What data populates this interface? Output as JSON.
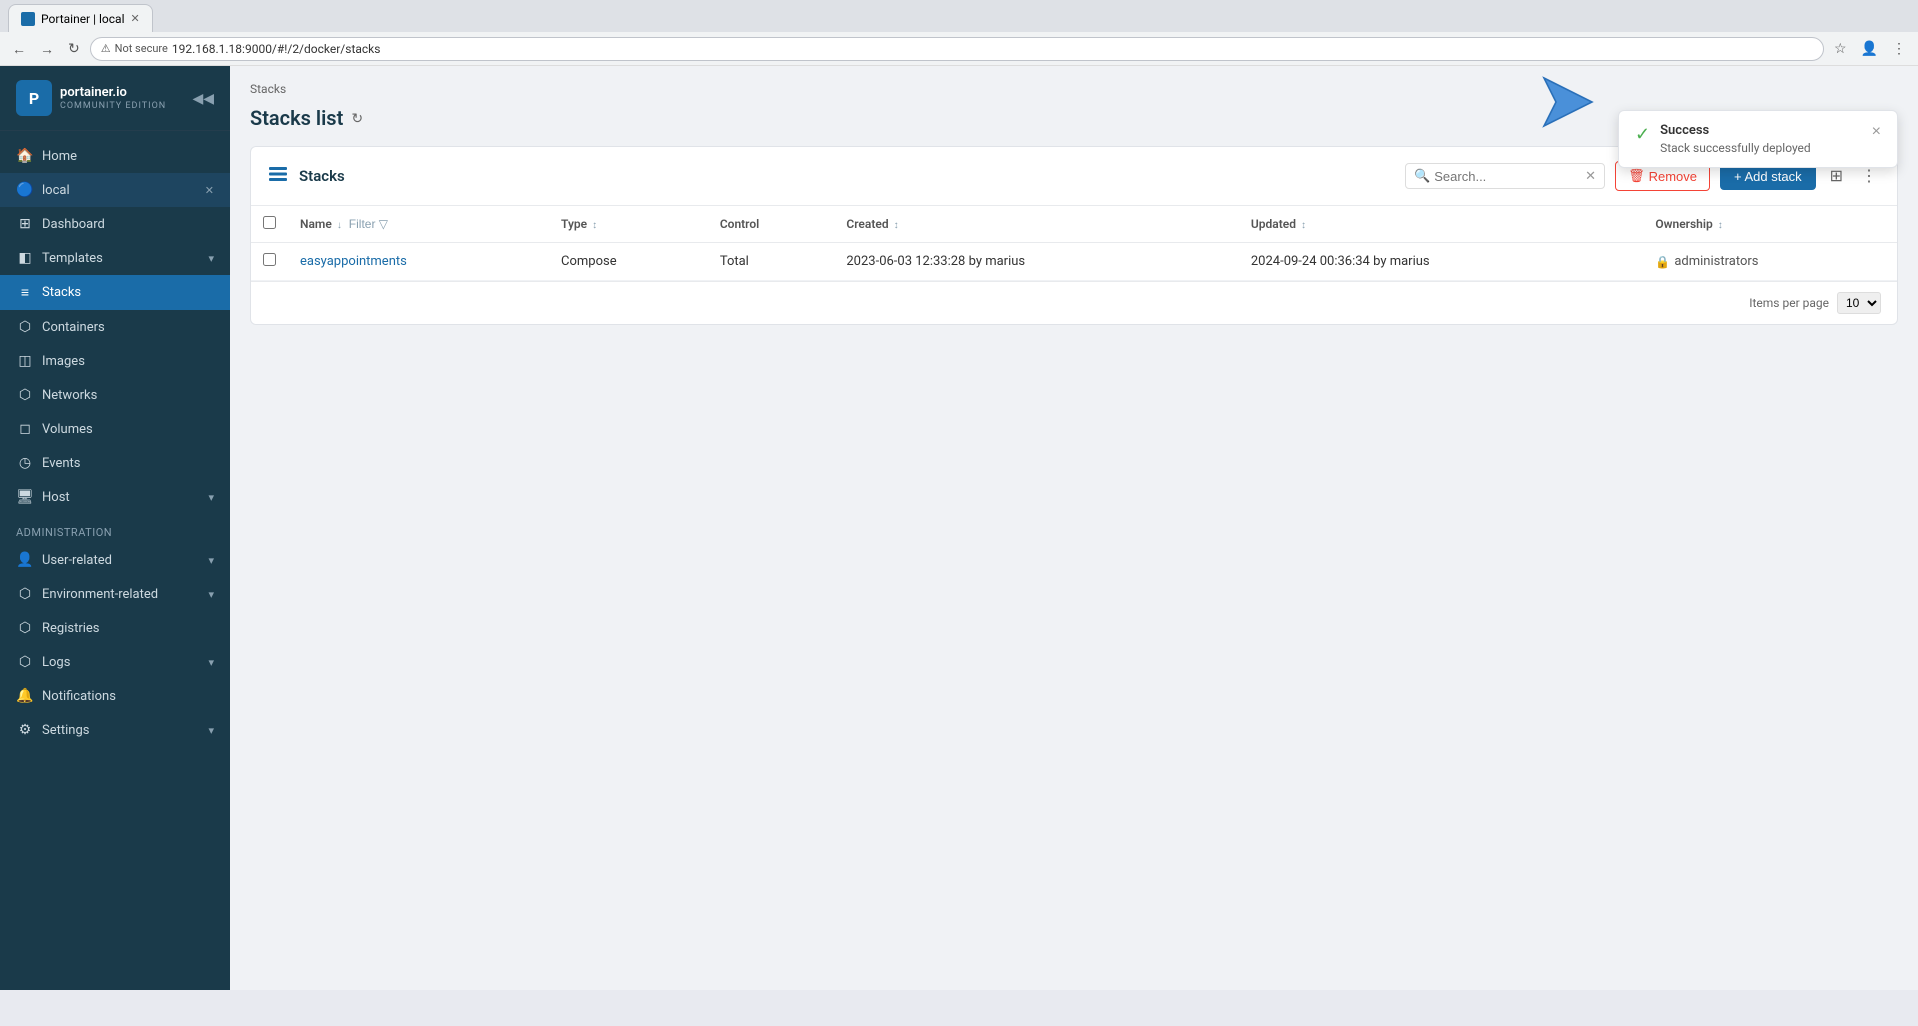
{
  "browser": {
    "tab_title": "Portainer | local",
    "address": "192.168.1.18:9000/#!/2/docker/stacks",
    "secure_label": "Not secure"
  },
  "sidebar": {
    "logo_text": "portainer.io",
    "logo_sub": "COMMUNITY EDITION",
    "home_label": "Home",
    "environment_label": "local",
    "nav_items": [
      {
        "id": "dashboard",
        "label": "Dashboard",
        "icon": "⊞"
      },
      {
        "id": "templates",
        "label": "Templates",
        "icon": "◧",
        "chevron": true
      },
      {
        "id": "stacks",
        "label": "Stacks",
        "icon": "≡",
        "active": true
      },
      {
        "id": "containers",
        "label": "Containers",
        "icon": "⬡"
      },
      {
        "id": "images",
        "label": "Images",
        "icon": "◫"
      },
      {
        "id": "networks",
        "label": "Networks",
        "icon": "⬡"
      },
      {
        "id": "volumes",
        "label": "Volumes",
        "icon": "◻"
      },
      {
        "id": "events",
        "label": "Events",
        "icon": "◷"
      },
      {
        "id": "host",
        "label": "Host",
        "icon": "⬡",
        "chevron": true
      }
    ],
    "admin_section": "Administration",
    "admin_items": [
      {
        "id": "user-related",
        "label": "User-related",
        "icon": "👤",
        "chevron": true
      },
      {
        "id": "environment-related",
        "label": "Environment-related",
        "icon": "⬡",
        "chevron": true
      },
      {
        "id": "registries",
        "label": "Registries",
        "icon": "⬡"
      },
      {
        "id": "logs",
        "label": "Logs",
        "icon": "⬡",
        "chevron": true
      },
      {
        "id": "notifications",
        "label": "Notifications",
        "icon": "🔔"
      },
      {
        "id": "settings",
        "label": "Settings",
        "icon": "⚙",
        "chevron": true
      }
    ]
  },
  "page": {
    "breadcrumb": "Stacks",
    "title": "Stacks list"
  },
  "stacks_card": {
    "title": "Stacks",
    "search_placeholder": "Search...",
    "remove_label": "Remove",
    "add_label": "+ Add stack",
    "columns": {
      "name": "Name",
      "type": "Type",
      "control": "Control",
      "created": "Created",
      "updated": "Updated",
      "ownership": "Ownership"
    },
    "filter_label": "Filter",
    "rows": [
      {
        "name": "easyappointments",
        "type": "Compose",
        "control": "Total",
        "created": "2023-06-03 12:33:28 by marius",
        "updated": "2024-09-24 00:36:34 by marius",
        "ownership": "administrators"
      }
    ],
    "items_per_page_label": "Items per page",
    "items_per_page_value": "10"
  },
  "toast": {
    "title": "Success",
    "message": "Stack successfully deployed",
    "close_label": "×"
  }
}
